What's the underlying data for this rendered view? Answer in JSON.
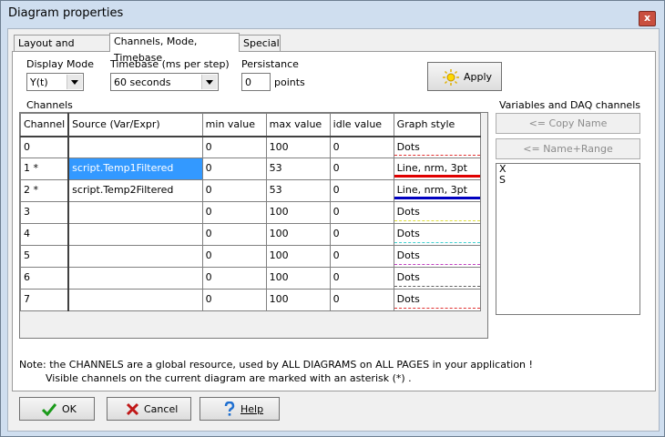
{
  "window": {
    "title": "Diagram properties",
    "close_label": "x"
  },
  "tabs": [
    {
      "label": "Layout and preview",
      "active": false
    },
    {
      "label": "Channels, Mode, Timebase",
      "active": true
    },
    {
      "label": "Special",
      "active": false
    }
  ],
  "display_mode": {
    "label": "Display Mode",
    "value": "Y(t)"
  },
  "timebase": {
    "label": "Timebase (ms per step)",
    "value": "60 seconds"
  },
  "persistance": {
    "label": "Persistance",
    "value": "0",
    "unit": "points"
  },
  "apply_button": {
    "label": "Apply",
    "icon": "sun-icon"
  },
  "channels": {
    "label": "Channels",
    "columns": [
      "Channel",
      "Source (Var/Expr)",
      "min value",
      "max value",
      "idle value",
      "Graph style"
    ],
    "rows": [
      {
        "channel": "0",
        "source": "",
        "min": "0",
        "max": "100",
        "idle": "0",
        "style": "Dots",
        "line_color": "#e03030",
        "line_style": "dashed",
        "selected": false
      },
      {
        "channel": "1 *",
        "source": "script.Temp1Filtered",
        "min": "0",
        "max": "53",
        "idle": "0",
        "style": "Line, nrm, 3pt",
        "line_color": "#e00000",
        "line_style": "solid",
        "selected": true
      },
      {
        "channel": "2 *",
        "source": "script.Temp2Filtered",
        "min": "0",
        "max": "53",
        "idle": "0",
        "style": "Line, nrm, 3pt",
        "line_color": "#0000c0",
        "line_style": "solid",
        "selected": false
      },
      {
        "channel": "3",
        "source": "",
        "min": "0",
        "max": "100",
        "idle": "0",
        "style": "Dots",
        "line_color": "#e0e040",
        "line_style": "dashed",
        "selected": false
      },
      {
        "channel": "4",
        "source": "",
        "min": "0",
        "max": "100",
        "idle": "0",
        "style": "Dots",
        "line_color": "#40d0d0",
        "line_style": "dashed",
        "selected": false
      },
      {
        "channel": "5",
        "source": "",
        "min": "0",
        "max": "100",
        "idle": "0",
        "style": "Dots",
        "line_color": "#c040c0",
        "line_style": "dashed",
        "selected": false
      },
      {
        "channel": "6",
        "source": "",
        "min": "0",
        "max": "100",
        "idle": "0",
        "style": "Dots",
        "line_color": "#606060",
        "line_style": "dashed",
        "selected": false
      },
      {
        "channel": "7",
        "source": "",
        "min": "0",
        "max": "100",
        "idle": "0",
        "style": "Dots",
        "line_color": "#e03030",
        "line_style": "dashed",
        "selected": false
      }
    ]
  },
  "variables": {
    "label": "Variables and DAQ channels",
    "copy_name_label": "<= Copy Name",
    "name_range_label": "<= Name+Range",
    "items": [
      "X",
      "S"
    ]
  },
  "note": {
    "line1": "Note: the CHANNELS are a global resource, used by ALL DIAGRAMS on ALL PAGES in your application !",
    "line2": "Visible channels on the current diagram are marked with an asterisk (*) ."
  },
  "footer": {
    "ok_label": "OK",
    "cancel_label": "Cancel",
    "help_label": "Help"
  },
  "colors": {
    "accent_selection": "#3399ff",
    "ok_check": "#1a9a1a",
    "cancel_x": "#c01818",
    "help_question": "#1f6fd0"
  }
}
